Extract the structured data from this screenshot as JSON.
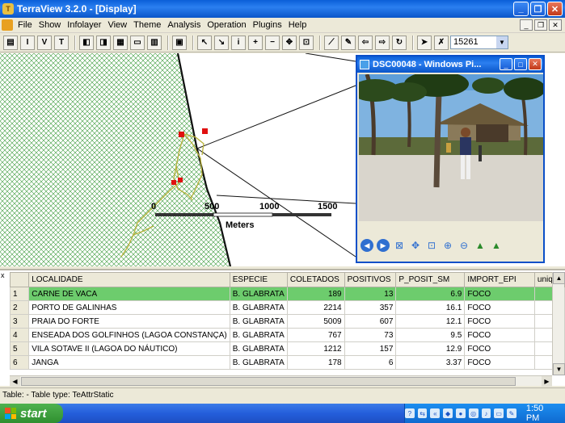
{
  "window": {
    "title": "TerraView 3.2.0 - [Display]",
    "minimize": "_",
    "restore": "❐",
    "close": "✕"
  },
  "menu": [
    "File",
    "Show",
    "Infolayer",
    "View",
    "Theme",
    "Analysis",
    "Operation",
    "Plugins",
    "Help"
  ],
  "toolbar": {
    "buttons": [
      "db-icon",
      "i-icon",
      "v-icon",
      "t-icon"
    ],
    "scale_value": "15261"
  },
  "map": {
    "scale_ticks": [
      "0",
      "500",
      "1000",
      "1500"
    ],
    "scale_unit": "Meters"
  },
  "picture_window": {
    "title": "DSC00048 - Windows Pi..."
  },
  "table": {
    "close": "x",
    "columns": [
      "LOCALIDADE",
      "ESPECIE",
      "COLETADOS",
      "POSITIVOS",
      "P_POSIT_SM",
      "IMPORT_EPI",
      "unique"
    ],
    "rows": [
      {
        "n": "1",
        "localidade": "CARNE DE VACA",
        "especie": "B. GLABRATA",
        "coletados": "189",
        "positivos": "13",
        "p_posit": "6.9",
        "import": "FOCO"
      },
      {
        "n": "2",
        "localidade": "PORTO DE GALINHAS",
        "especie": "B. GLABRATA",
        "coletados": "2214",
        "positivos": "357",
        "p_posit": "16.1",
        "import": "FOCO"
      },
      {
        "n": "3",
        "localidade": "PRAIA DO FORTE",
        "especie": "B. GLABRATA",
        "coletados": "5009",
        "positivos": "607",
        "p_posit": "12.1",
        "import": "FOCO"
      },
      {
        "n": "4",
        "localidade": "ENSEADA DOS GOLFINHOS (LAGOA CONSTANÇA)",
        "especie": "B. GLABRATA",
        "coletados": "767",
        "positivos": "73",
        "p_posit": "9.5",
        "import": "FOCO"
      },
      {
        "n": "5",
        "localidade": "VILA SOTAVE II (LAGOA DO NÁUTICO)",
        "especie": "B. GLABRATA",
        "coletados": "1212",
        "positivos": "157",
        "p_posit": "12.9",
        "import": "FOCO"
      },
      {
        "n": "6",
        "localidade": "JANGA",
        "especie": "B. GLABRATA",
        "coletados": "178",
        "positivos": "6",
        "p_posit": "3.37",
        "import": "FOCO"
      }
    ]
  },
  "status": "Table:  - Table type: TeAttrStatic",
  "taskbar": {
    "start": "start",
    "clock": "1:50 PM"
  },
  "colors": {
    "selected_row": "#6dcc6d",
    "hatch": "#3a9a3a",
    "point": "#e01010"
  }
}
